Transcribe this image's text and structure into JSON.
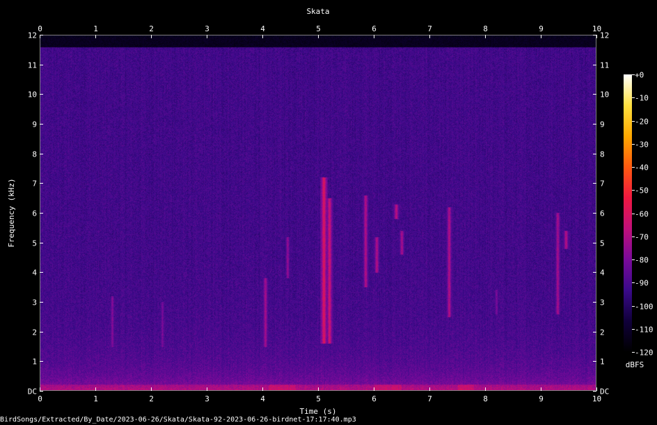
{
  "chart_data": {
    "type": "heatmap",
    "title": "Skata",
    "xlabel": "Time (s)",
    "ylabel": "Frequency (kHz)",
    "xlim": [
      0,
      10
    ],
    "ylim": [
      0,
      12
    ],
    "x_ticks": [
      "0",
      "1",
      "2",
      "3",
      "4",
      "5",
      "6",
      "7",
      "8",
      "9",
      "10"
    ],
    "y_ticks": [
      "DC",
      "1",
      "2",
      "3",
      "4",
      "5",
      "6",
      "7",
      "8",
      "9",
      "10",
      "11",
      "12"
    ],
    "colorbar": {
      "label": "dBFS",
      "range": [
        -120,
        0
      ],
      "ticks": [
        "+0",
        "-10",
        "-20",
        "-30",
        "-40",
        "-50",
        "-60",
        "-70",
        "-80",
        "-90",
        "-100",
        "-110",
        "-120"
      ],
      "colors": [
        "#000000",
        "#10003a",
        "#3a0a8a",
        "#7a0a9a",
        "#c0107a",
        "#f01840",
        "#ff5a10",
        "#ffa800",
        "#ffe040",
        "#ffffff"
      ]
    },
    "background_level_dbfs": -92,
    "noise_cutoff_khz": 11.6,
    "calls": [
      {
        "t": 1.3,
        "f0": 1.5,
        "f1": 3.2,
        "level": -78
      },
      {
        "t": 2.2,
        "f0": 1.5,
        "f1": 3.0,
        "level": -80
      },
      {
        "t": 4.05,
        "f0": 1.5,
        "f1": 3.8,
        "level": -72
      },
      {
        "t": 4.45,
        "f0": 3.8,
        "f1": 5.2,
        "level": -76
      },
      {
        "t": 5.1,
        "f0": 1.6,
        "f1": 7.2,
        "level": -60
      },
      {
        "t": 5.2,
        "f0": 1.6,
        "f1": 6.5,
        "level": -64
      },
      {
        "t": 5.85,
        "f0": 3.5,
        "f1": 6.6,
        "level": -70
      },
      {
        "t": 6.05,
        "f0": 4.0,
        "f1": 5.2,
        "level": -70
      },
      {
        "t": 6.4,
        "f0": 5.8,
        "f1": 6.3,
        "level": -68
      },
      {
        "t": 6.5,
        "f0": 4.6,
        "f1": 5.4,
        "level": -72
      },
      {
        "t": 7.35,
        "f0": 2.5,
        "f1": 6.2,
        "level": -70
      },
      {
        "t": 8.2,
        "f0": 2.6,
        "f1": 3.4,
        "level": -80
      },
      {
        "t": 9.3,
        "f0": 2.6,
        "f1": 6.0,
        "level": -72
      },
      {
        "t": 9.45,
        "f0": 4.8,
        "f1": 5.4,
        "level": -70
      }
    ]
  },
  "footer": {
    "path": "BirdSongs/Extracted/By_Date/2023-06-26/Skata/Skata-92-2023-06-26-birdnet-17:17:40.mp3"
  }
}
